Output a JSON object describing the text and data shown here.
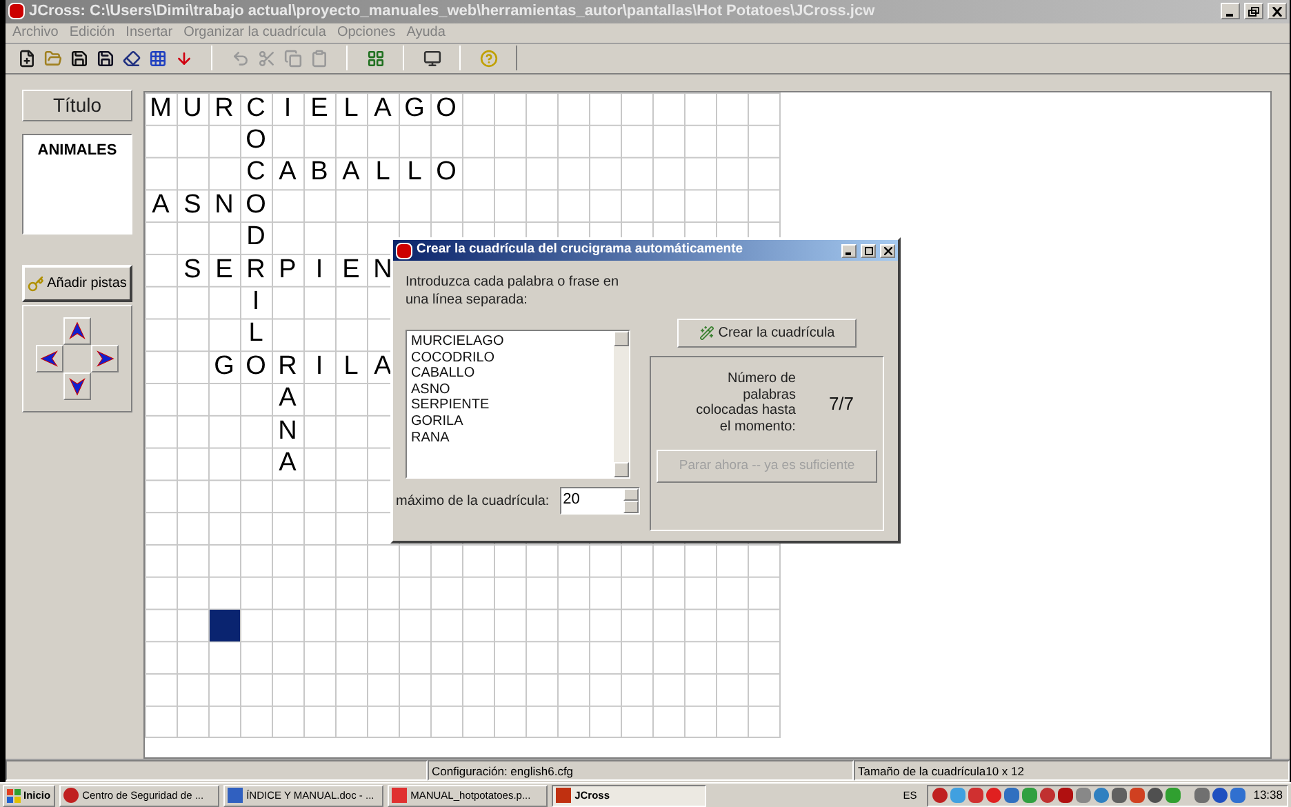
{
  "window": {
    "title": "JCross: C:\\Users\\Dimi\\trabajo actual\\proyecto_manuales_web\\herramientas_autor\\pantallas\\Hot Potatoes\\JCross.jcw"
  },
  "menu": [
    "Archivo",
    "Edición",
    "Insertar",
    "Organizar la cuadrícula",
    "Opciones",
    "Ayuda"
  ],
  "title_button": "Título",
  "title_text": "ANIMALES",
  "add_clues_button": "Añadir pistas",
  "grid": {
    "rows": [
      [
        "M",
        "U",
        "R",
        "C",
        "I",
        "E",
        "L",
        "A",
        "G",
        "O"
      ],
      [
        null,
        null,
        null,
        "O"
      ],
      [
        null,
        null,
        null,
        "C",
        "A",
        "B",
        "A",
        "L",
        "L",
        "O"
      ],
      [
        "A",
        "S",
        "N",
        "O"
      ],
      [
        null,
        null,
        null,
        "D"
      ],
      [
        null,
        "S",
        "E",
        "R",
        "P",
        "I",
        "E",
        "N"
      ],
      [
        null,
        null,
        null,
        "I"
      ],
      [
        null,
        null,
        null,
        "L"
      ],
      [
        null,
        null,
        "G",
        "O",
        "R",
        "I",
        "L",
        "A"
      ],
      [
        null,
        null,
        null,
        null,
        "A"
      ],
      [
        null,
        null,
        null,
        null,
        "N"
      ],
      [
        null,
        null,
        null,
        null,
        "A"
      ],
      [
        null
      ],
      [
        null
      ],
      [
        null
      ],
      [
        null
      ],
      [
        null,
        null,
        {
          "selected": true
        }
      ]
    ]
  },
  "dialog": {
    "title": "Crear la cuadrícula del crucigrama automáticamente",
    "instruction": "Introduzca cada palabra o frase en una línea separada:",
    "words": [
      "MURCIELAGO",
      "COCODRILO",
      "CABALLO",
      "ASNO",
      "SERPIENTE",
      "GORILA",
      "RANA"
    ],
    "max_label": "máximo de la cuadrícula:",
    "max_value": "20",
    "create_button": "Crear la cuadrícula",
    "count_label": "Número de palabras colocadas hasta el momento:",
    "count_value": "7/7",
    "stop_button": {
      "label": "Parar ahora -- ya es suficiente",
      "disabled": true
    }
  },
  "status_bar": [
    "Configuración: english6.cfg",
    "Tamaño de la cuadrícula10 x 12"
  ],
  "taskbar": {
    "start": "Inicio",
    "tasks": [
      {
        "label": "Centro de Seguridad de ...",
        "selected": false
      },
      {
        "label": "ÍNDICE Y MANUAL.doc - ...",
        "selected": false
      },
      {
        "label": "MANUAL_hotpotatoes.p...",
        "selected": false
      },
      {
        "label": "JCross",
        "selected": true
      }
    ],
    "language": "ES",
    "clock": "13:38"
  }
}
